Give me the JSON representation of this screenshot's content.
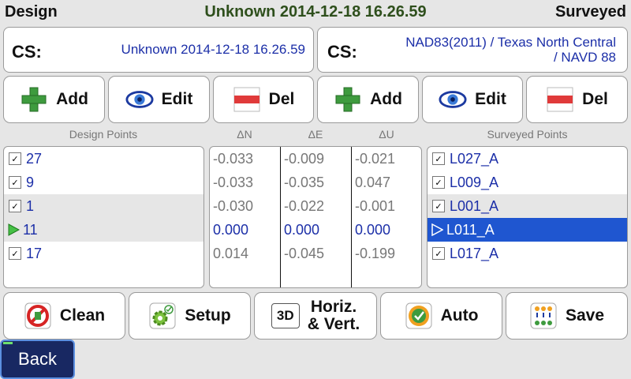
{
  "header": {
    "left": "Design",
    "center": "Unknown 2014-12-18 16.26.59",
    "right": "Surveyed"
  },
  "cs": {
    "label": "CS:",
    "design_value": "Unknown 2014-12-18 16.26.59",
    "survey_value_line1": "NAD83(2011) / Texas North Central",
    "survey_value_line2": "/ NAVD 88"
  },
  "toolbar_top": {
    "add": "Add",
    "edit": "Edit",
    "del": "Del"
  },
  "headers": {
    "design_points": "Design Points",
    "dn": "ΔN",
    "de": "ΔE",
    "du": "ΔU",
    "surveyed_points": "Surveyed Points"
  },
  "design_points": [
    {
      "name": "27",
      "checked": true
    },
    {
      "name": "9",
      "checked": true
    },
    {
      "name": "1",
      "checked": true
    },
    {
      "name": "11",
      "current": true
    },
    {
      "name": "17",
      "checked": true
    }
  ],
  "deltas": [
    {
      "dn": "-0.033",
      "de": "-0.009",
      "du": "-0.021"
    },
    {
      "dn": "-0.033",
      "de": "-0.035",
      "du": "0.047"
    },
    {
      "dn": "-0.030",
      "de": "-0.022",
      "du": "-0.001"
    },
    {
      "dn": "0.000",
      "de": "0.000",
      "du": "0.000"
    },
    {
      "dn": "0.014",
      "de": "-0.045",
      "du": "-0.199"
    }
  ],
  "surveyed_points": [
    {
      "name": "L027_A",
      "checked": true
    },
    {
      "name": "L009_A",
      "checked": true
    },
    {
      "name": "L001_A",
      "checked": true
    },
    {
      "name": "L011_A",
      "selected": true
    },
    {
      "name": "L017_A",
      "checked": true
    }
  ],
  "toolbar_bottom": {
    "clean": "Clean",
    "setup": "Setup",
    "mode_icon_text": "3D",
    "mode_line1": "Horiz.",
    "mode_line2": "& Vert.",
    "auto": "Auto",
    "save": "Save"
  },
  "footer": {
    "back": "Back"
  },
  "colors": {
    "accent_blue": "#1c2fa8",
    "selection": "#1f56d0",
    "title_green": "#2e4f1c",
    "back_bg": "#182862"
  }
}
